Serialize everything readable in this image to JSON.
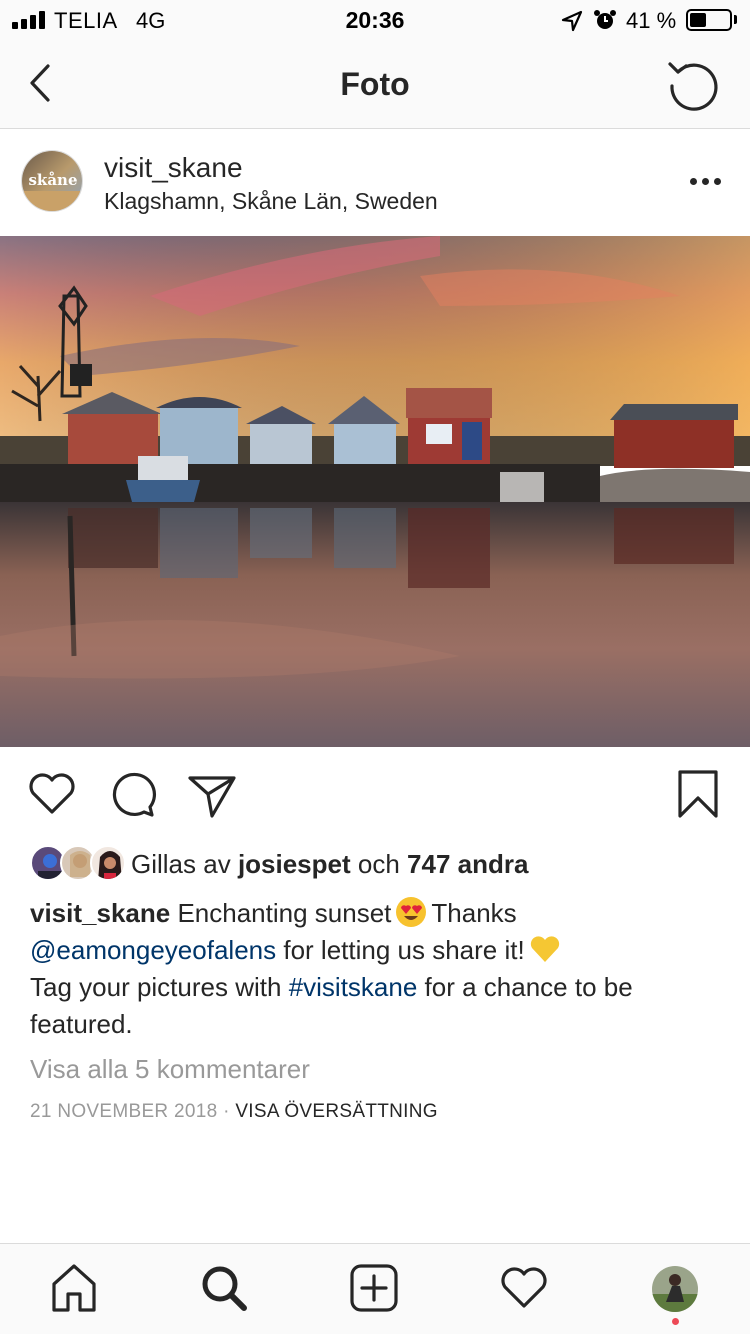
{
  "status_bar": {
    "carrier": "TELIA",
    "network": "4G",
    "time": "20:36",
    "battery_percent": "41 %",
    "battery_level": 0.41,
    "icons": [
      "signal-icon",
      "location-arrow-icon",
      "alarm-icon",
      "battery-icon"
    ]
  },
  "header": {
    "title": "Foto",
    "back_icon": "chevron-left-icon",
    "refresh_icon": "refresh-icon"
  },
  "post": {
    "avatar_text": "skåne",
    "username": "visit_skane",
    "location": "Klagshamn, Skåne Län, Sweden",
    "more_icon": "more-icon"
  },
  "actions": {
    "icons": [
      "heart-icon",
      "comment-icon",
      "share-icon",
      "bookmark-icon"
    ]
  },
  "likes": {
    "prefix": "Gillas av",
    "user": "josiespet",
    "connector": "och",
    "count": "747 andra"
  },
  "caption": {
    "username": "visit_skane",
    "text_1": "Enchanting sunset",
    "emoji_1": "heart-eyes-emoji",
    "text_2": "Thanks",
    "mention": "@eamongeyeofalens",
    "text_3": "for letting us share it!",
    "emoji_2": "yellow-heart-emoji",
    "text_4": "Tag your pictures with",
    "hashtag": "#visitskane",
    "text_5": "for a chance to be featured."
  },
  "comments": {
    "view_all": "Visa alla 5 kommentarer"
  },
  "meta": {
    "date": "21 NOVEMBER 2018",
    "separator": "·",
    "translate": "VISA ÖVERSÄTTNING"
  },
  "bottom_nav": {
    "icons": [
      "home-icon",
      "search-icon",
      "add-post-icon",
      "activity-heart-icon",
      "profile-avatar"
    ]
  },
  "colors": {
    "text": "#262626",
    "muted": "#999999",
    "link": "#003569",
    "border": "#dbdbdb",
    "notification_dot": "#ed4956"
  }
}
